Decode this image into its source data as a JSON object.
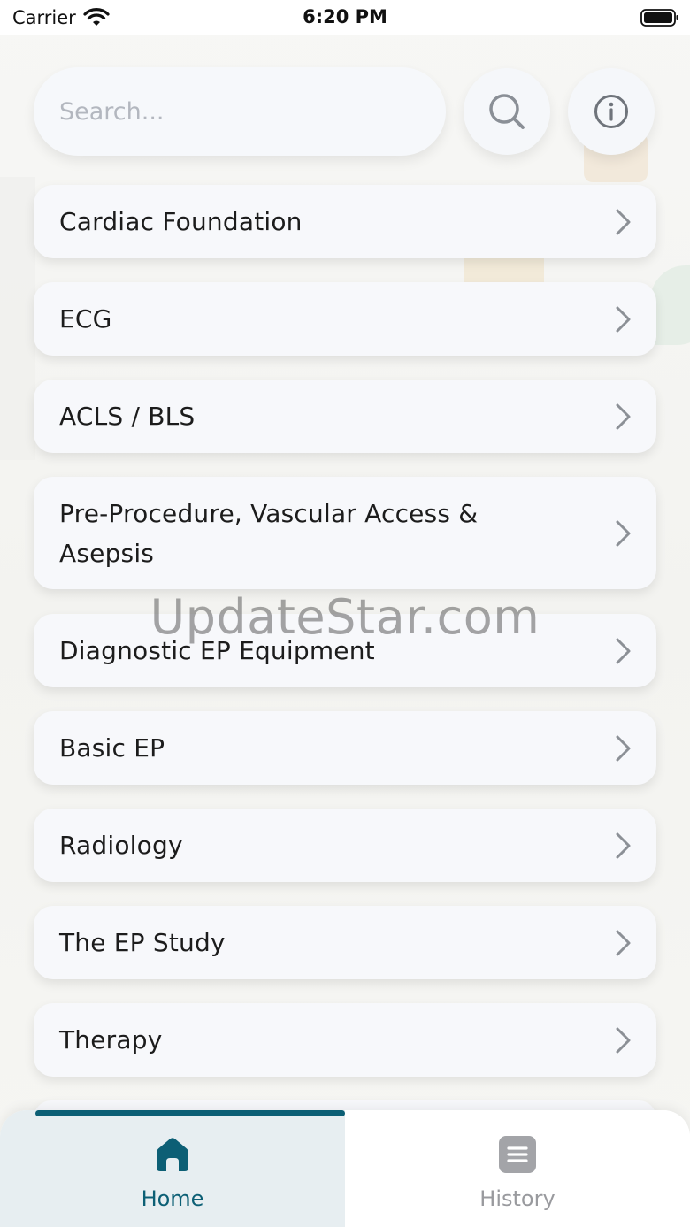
{
  "status_bar": {
    "carrier": "Carrier",
    "time": "6:20 PM",
    "wifi_icon": "wifi-icon",
    "battery_icon": "battery-icon"
  },
  "search": {
    "placeholder": "Search...",
    "value": "",
    "search_icon": "search-icon",
    "info_icon": "info-icon"
  },
  "menu": {
    "items": [
      {
        "label": "Cardiac Foundation"
      },
      {
        "label": "ECG"
      },
      {
        "label": "ACLS / BLS"
      },
      {
        "label": "Pre-Procedure, Vascular Access & Asepsis"
      },
      {
        "label": "Diagnostic EP Equipment"
      },
      {
        "label": "Basic EP"
      },
      {
        "label": "Radiology"
      },
      {
        "label": "The EP Study"
      },
      {
        "label": "Therapy"
      }
    ],
    "chevron_icon": "chevron-right-icon"
  },
  "watermark": "UpdateStar.com",
  "tab_bar": {
    "tabs": [
      {
        "label": "Home",
        "icon": "home-icon",
        "active": true
      },
      {
        "label": "History",
        "icon": "history-icon",
        "active": false
      }
    ]
  },
  "colors": {
    "accent": "#0c5f75",
    "inactive": "#999a9e",
    "card_bg": "#f7f8fb",
    "active_tab_bg": "#e7eef1"
  }
}
